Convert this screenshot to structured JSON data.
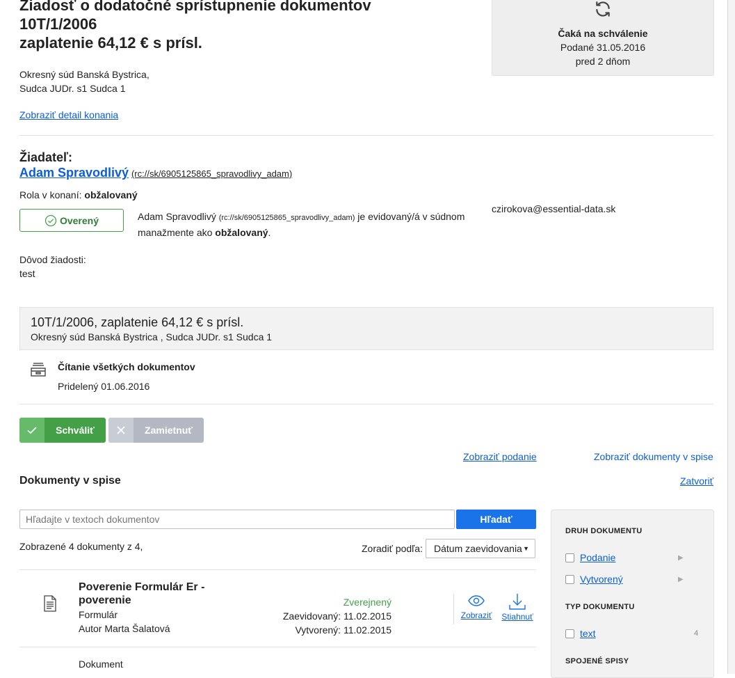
{
  "header": {
    "title_line1": "Žiadosť o dodatočné sprístupnenie dokumentov",
    "title_line2": "10T/1/2006",
    "title_line3": "zaplatenie 64,12 € s prísl.",
    "court": "Okresný súd Banská Bystrica,",
    "judge": "Sudca JUDr. s1 Sudca 1",
    "detail_link": "Zobraziť detail konania"
  },
  "status": {
    "icon": "refresh-icon",
    "label": "Čaká na schválenie",
    "submitted": "Podané 31.05.2016",
    "ago": "pred 2 dňom"
  },
  "applicant": {
    "heading": "Žiadateľ:",
    "name": "Adam Spravodlivý",
    "id": "(rc://sk/6905125865_spravodlivy_adam)",
    "role_label": "Rola v konaní:",
    "role": "obžalovaný",
    "verified": "Overený",
    "desc_name": "Adam Spravodlivý",
    "desc_id": "(rc://sk/6905125865_spravodlivy_adam)",
    "desc_mid": "je evidovaný/á v súdnom",
    "desc_line2": "manažmente ako",
    "desc_role": "obžalovaný",
    "email": "czirokova@essential-data.sk",
    "reason_label": "Dôvod žiadosti:",
    "reason": "test"
  },
  "case": {
    "title": "10T/1/2006, zaplatenie 64,12 € s prísl.",
    "subtitle": "Okresný súd Banská Bystrica , Sudca JUDr. s1 Sudca 1"
  },
  "permission": {
    "icon": "archive-tray-icon",
    "title": "Čítanie všetkých dokumentov",
    "assigned": "Pridelený 01.06.2016"
  },
  "actions": {
    "approve": "Schváliť",
    "reject": "Zamietnuť",
    "show_filing": "Zobraziť podanie",
    "show_docs": "Zobraziť dokumenty v spise",
    "close": "Zatvoriť"
  },
  "documents": {
    "heading": "Dokumenty v spise",
    "search_placeholder": "Hľadajte v textoch dokumentov",
    "search_button": "Hľadať",
    "count_text": "Zobrazené 4 dokumenty z 4,",
    "sort_label": "Zoradiť podľa:",
    "sort_value": "Dátum zaevidovania",
    "items": [
      {
        "title_line1": "Poverenie Formulár Er -",
        "title_line2": "poverenie",
        "type": "Formulár",
        "author": "Autor Marta Šalatová",
        "status": "Zverejnený",
        "registered": "Zaevidovaný: 11.02.2015",
        "created": "Vytvorený: 11.02.2015",
        "view": "Zobraziť",
        "download": "Stiahnuť"
      },
      {
        "title_line1": "Dokument"
      }
    ]
  },
  "filters": {
    "doc_kind_heading": "DRUH DOKUMENTU",
    "doc_kind_items": [
      "Podanie",
      "Vytvorený"
    ],
    "doc_type_heading": "TYP DOKUMENTU",
    "doc_type_items": [
      {
        "label": "text",
        "count": "4"
      }
    ],
    "linked_heading": "SPOJENÉ SPISY"
  },
  "colors": {
    "link": "#0b5ed7",
    "approve": "#43a047",
    "reject": "#b3b8c3",
    "search_button": "#1a73e8",
    "published": "#43a047"
  }
}
